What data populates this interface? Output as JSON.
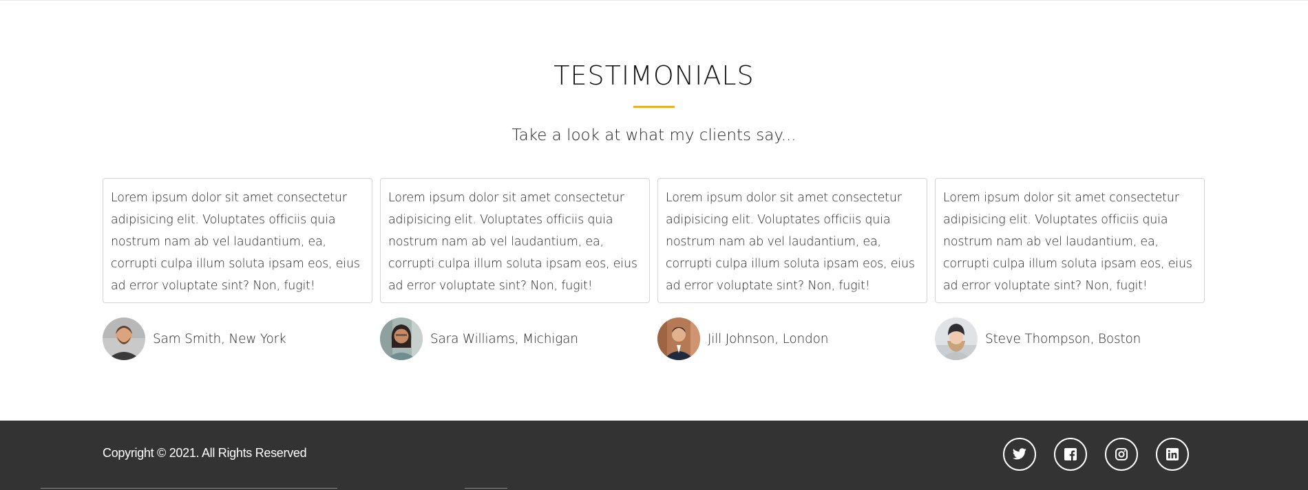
{
  "testimonials": {
    "title": "TESTIMONIALS",
    "subtitle": "Take a look at what my clients say...",
    "accent_color": "#f5b301",
    "items": [
      {
        "quote": "Lorem ipsum dolor sit amet consectetur adipisicing elit. Voluptates officiis quia nostrum nam ab vel laudantium, ea, corrupti culpa illum soluta ipsam eos, eius ad error voluptate sint? Non, fugit!",
        "author": "Sam Smith, New York"
      },
      {
        "quote": "Lorem ipsum dolor sit amet consectetur adipisicing elit. Voluptates officiis quia nostrum nam ab vel laudantium, ea, corrupti culpa illum soluta ipsam eos, eius ad error voluptate sint? Non, fugit!",
        "author": "Sara Williams, Michigan"
      },
      {
        "quote": "Lorem ipsum dolor sit amet consectetur adipisicing elit. Voluptates officiis quia nostrum nam ab vel laudantium, ea, corrupti culpa illum soluta ipsam eos, eius ad error voluptate sint? Non, fugit!",
        "author": "Jill Johnson, London"
      },
      {
        "quote": "Lorem ipsum dolor sit amet consectetur adipisicing elit. Voluptates officiis quia nostrum nam ab vel laudantium, ea, corrupti culpa illum soluta ipsam eos, eius ad error voluptate sint? Non, fugit!",
        "author": "Steve Thompson, Boston"
      }
    ]
  },
  "footer": {
    "copyright": "Copyright © 2021. All Rights Reserved",
    "background_color": "#333333",
    "social": [
      {
        "icon": "twitter-icon"
      },
      {
        "icon": "facebook-icon"
      },
      {
        "icon": "instagram-icon"
      },
      {
        "icon": "linkedin-icon"
      }
    ]
  }
}
